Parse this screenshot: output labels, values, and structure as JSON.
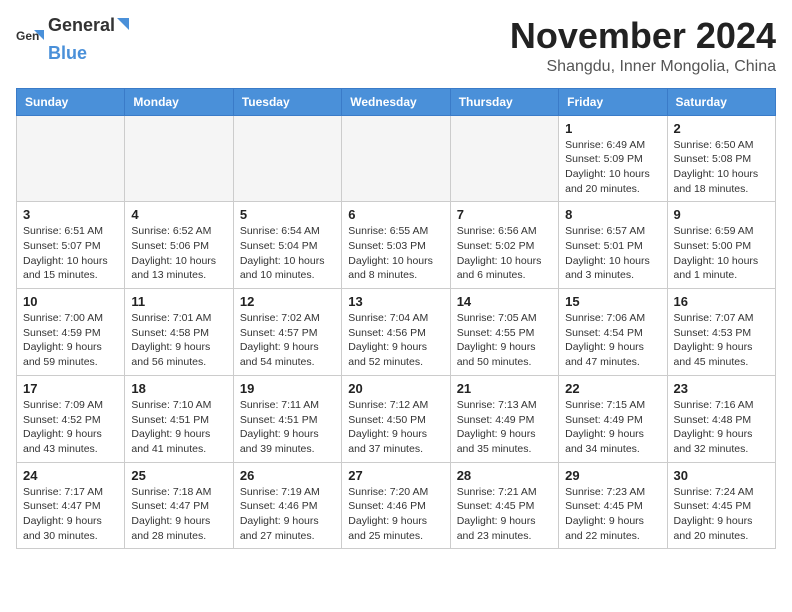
{
  "header": {
    "logo_general": "General",
    "logo_blue": "Blue",
    "month_title": "November 2024",
    "location": "Shangdu, Inner Mongolia, China"
  },
  "weekdays": [
    "Sunday",
    "Monday",
    "Tuesday",
    "Wednesday",
    "Thursday",
    "Friday",
    "Saturday"
  ],
  "weeks": [
    [
      {
        "day": "",
        "empty": true
      },
      {
        "day": "",
        "empty": true
      },
      {
        "day": "",
        "empty": true
      },
      {
        "day": "",
        "empty": true
      },
      {
        "day": "",
        "empty": true
      },
      {
        "day": "1",
        "sunrise": "Sunrise: 6:49 AM",
        "sunset": "Sunset: 5:09 PM",
        "daylight": "Daylight: 10 hours and 20 minutes."
      },
      {
        "day": "2",
        "sunrise": "Sunrise: 6:50 AM",
        "sunset": "Sunset: 5:08 PM",
        "daylight": "Daylight: 10 hours and 18 minutes."
      }
    ],
    [
      {
        "day": "3",
        "sunrise": "Sunrise: 6:51 AM",
        "sunset": "Sunset: 5:07 PM",
        "daylight": "Daylight: 10 hours and 15 minutes."
      },
      {
        "day": "4",
        "sunrise": "Sunrise: 6:52 AM",
        "sunset": "Sunset: 5:06 PM",
        "daylight": "Daylight: 10 hours and 13 minutes."
      },
      {
        "day": "5",
        "sunrise": "Sunrise: 6:54 AM",
        "sunset": "Sunset: 5:04 PM",
        "daylight": "Daylight: 10 hours and 10 minutes."
      },
      {
        "day": "6",
        "sunrise": "Sunrise: 6:55 AM",
        "sunset": "Sunset: 5:03 PM",
        "daylight": "Daylight: 10 hours and 8 minutes."
      },
      {
        "day": "7",
        "sunrise": "Sunrise: 6:56 AM",
        "sunset": "Sunset: 5:02 PM",
        "daylight": "Daylight: 10 hours and 6 minutes."
      },
      {
        "day": "8",
        "sunrise": "Sunrise: 6:57 AM",
        "sunset": "Sunset: 5:01 PM",
        "daylight": "Daylight: 10 hours and 3 minutes."
      },
      {
        "day": "9",
        "sunrise": "Sunrise: 6:59 AM",
        "sunset": "Sunset: 5:00 PM",
        "daylight": "Daylight: 10 hours and 1 minute."
      }
    ],
    [
      {
        "day": "10",
        "sunrise": "Sunrise: 7:00 AM",
        "sunset": "Sunset: 4:59 PM",
        "daylight": "Daylight: 9 hours and 59 minutes."
      },
      {
        "day": "11",
        "sunrise": "Sunrise: 7:01 AM",
        "sunset": "Sunset: 4:58 PM",
        "daylight": "Daylight: 9 hours and 56 minutes."
      },
      {
        "day": "12",
        "sunrise": "Sunrise: 7:02 AM",
        "sunset": "Sunset: 4:57 PM",
        "daylight": "Daylight: 9 hours and 54 minutes."
      },
      {
        "day": "13",
        "sunrise": "Sunrise: 7:04 AM",
        "sunset": "Sunset: 4:56 PM",
        "daylight": "Daylight: 9 hours and 52 minutes."
      },
      {
        "day": "14",
        "sunrise": "Sunrise: 7:05 AM",
        "sunset": "Sunset: 4:55 PM",
        "daylight": "Daylight: 9 hours and 50 minutes."
      },
      {
        "day": "15",
        "sunrise": "Sunrise: 7:06 AM",
        "sunset": "Sunset: 4:54 PM",
        "daylight": "Daylight: 9 hours and 47 minutes."
      },
      {
        "day": "16",
        "sunrise": "Sunrise: 7:07 AM",
        "sunset": "Sunset: 4:53 PM",
        "daylight": "Daylight: 9 hours and 45 minutes."
      }
    ],
    [
      {
        "day": "17",
        "sunrise": "Sunrise: 7:09 AM",
        "sunset": "Sunset: 4:52 PM",
        "daylight": "Daylight: 9 hours and 43 minutes."
      },
      {
        "day": "18",
        "sunrise": "Sunrise: 7:10 AM",
        "sunset": "Sunset: 4:51 PM",
        "daylight": "Daylight: 9 hours and 41 minutes."
      },
      {
        "day": "19",
        "sunrise": "Sunrise: 7:11 AM",
        "sunset": "Sunset: 4:51 PM",
        "daylight": "Daylight: 9 hours and 39 minutes."
      },
      {
        "day": "20",
        "sunrise": "Sunrise: 7:12 AM",
        "sunset": "Sunset: 4:50 PM",
        "daylight": "Daylight: 9 hours and 37 minutes."
      },
      {
        "day": "21",
        "sunrise": "Sunrise: 7:13 AM",
        "sunset": "Sunset: 4:49 PM",
        "daylight": "Daylight: 9 hours and 35 minutes."
      },
      {
        "day": "22",
        "sunrise": "Sunrise: 7:15 AM",
        "sunset": "Sunset: 4:49 PM",
        "daylight": "Daylight: 9 hours and 34 minutes."
      },
      {
        "day": "23",
        "sunrise": "Sunrise: 7:16 AM",
        "sunset": "Sunset: 4:48 PM",
        "daylight": "Daylight: 9 hours and 32 minutes."
      }
    ],
    [
      {
        "day": "24",
        "sunrise": "Sunrise: 7:17 AM",
        "sunset": "Sunset: 4:47 PM",
        "daylight": "Daylight: 9 hours and 30 minutes."
      },
      {
        "day": "25",
        "sunrise": "Sunrise: 7:18 AM",
        "sunset": "Sunset: 4:47 PM",
        "daylight": "Daylight: 9 hours and 28 minutes."
      },
      {
        "day": "26",
        "sunrise": "Sunrise: 7:19 AM",
        "sunset": "Sunset: 4:46 PM",
        "daylight": "Daylight: 9 hours and 27 minutes."
      },
      {
        "day": "27",
        "sunrise": "Sunrise: 7:20 AM",
        "sunset": "Sunset: 4:46 PM",
        "daylight": "Daylight: 9 hours and 25 minutes."
      },
      {
        "day": "28",
        "sunrise": "Sunrise: 7:21 AM",
        "sunset": "Sunset: 4:45 PM",
        "daylight": "Daylight: 9 hours and 23 minutes."
      },
      {
        "day": "29",
        "sunrise": "Sunrise: 7:23 AM",
        "sunset": "Sunset: 4:45 PM",
        "daylight": "Daylight: 9 hours and 22 minutes."
      },
      {
        "day": "30",
        "sunrise": "Sunrise: 7:24 AM",
        "sunset": "Sunset: 4:45 PM",
        "daylight": "Daylight: 9 hours and 20 minutes."
      }
    ]
  ]
}
